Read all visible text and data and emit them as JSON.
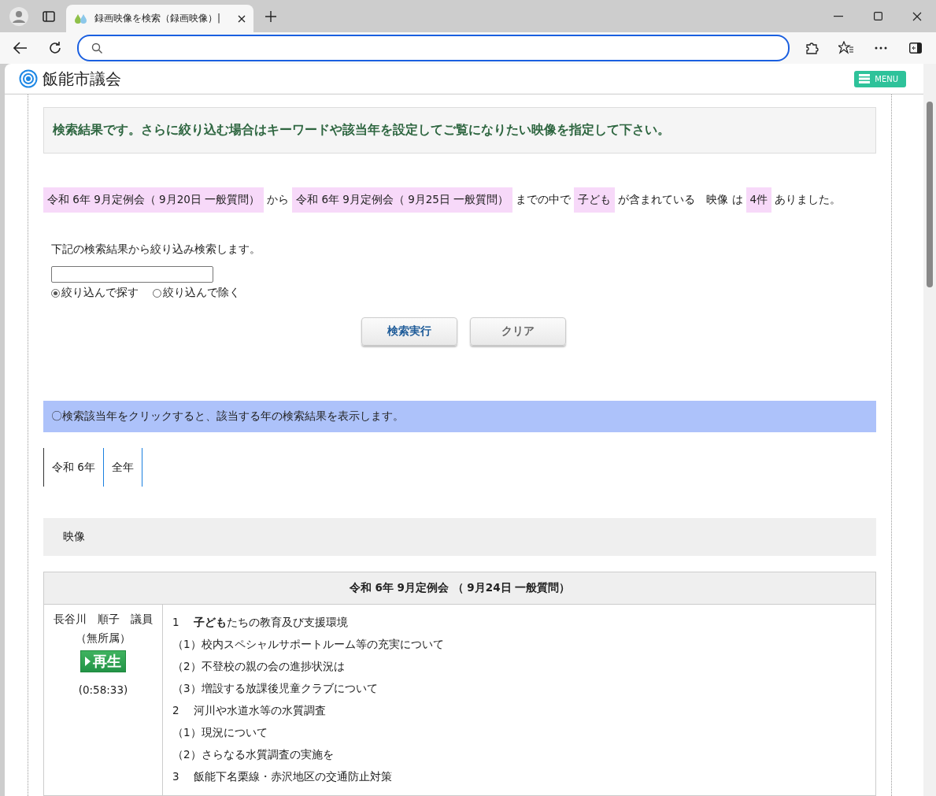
{
  "browser": {
    "tab_title": "録画映像を検索（録画映像）|"
  },
  "site": {
    "title": "飯能市議会",
    "menu_label": "MENU"
  },
  "notice": "検索結果です。さらに絞り込む場合はキーワードや該当年を設定してご覧になりたい映像を指定して下さい。",
  "summary": [
    {
      "kind": "tag",
      "text": "令和 6年 9月定例会（ 9月20日 一般質問）"
    },
    {
      "kind": "plain",
      "text": "から"
    },
    {
      "kind": "tag",
      "text": "令和 6年 9月定例会（ 9月25日 一般質問）"
    },
    {
      "kind": "plain",
      "text": "までの中で"
    },
    {
      "kind": "tag",
      "text": "子ども"
    },
    {
      "kind": "plain",
      "text": "が含まれている　映像 は"
    },
    {
      "kind": "tag",
      "text": "4件"
    },
    {
      "kind": "plain",
      "text": "ありました。"
    }
  ],
  "refine": {
    "label": "下記の検索結果から絞り込み検索します。",
    "options": [
      {
        "label": "絞り込んで探す",
        "selected": true
      },
      {
        "label": "絞り込んで除く",
        "selected": false
      }
    ],
    "buttons": [
      {
        "label": "検索実行",
        "kind": "primary"
      },
      {
        "label": "クリア",
        "kind": "secondary"
      }
    ]
  },
  "year_hint": "〇検索該当年をクリックすると、該当する年の検索結果を表示します。",
  "years": [
    "令和 6年",
    "全年"
  ],
  "section_title": "映像",
  "results": [
    {
      "title": "令和 6年 9月定例会 （ 9月24日 一般質問）",
      "speaker": "長谷川　順子　議員",
      "party": "（無所属）",
      "play_label": "再生",
      "duration": "(0:58:33)",
      "items": [
        {
          "kind": "topic",
          "number": "1",
          "text": "**子ども**たちの教育及び支援環境"
        },
        {
          "kind": "sub",
          "text": "（1）校内スペシャルサポートルーム等の充実について"
        },
        {
          "kind": "sub",
          "text": "（2）不登校の親の会の進捗状況は"
        },
        {
          "kind": "sub",
          "text": "（3）増設する放課後児童クラブについて"
        },
        {
          "kind": "topic",
          "number": "2",
          "text": "河川や水道水等の水質調査"
        },
        {
          "kind": "sub",
          "text": "（1）現況について"
        },
        {
          "kind": "sub",
          "text": "（2）さらなる水質調査の実施を"
        },
        {
          "kind": "topic",
          "number": "3",
          "text": "飯能下名栗線・赤沢地区の交通防止対策"
        }
      ]
    }
  ]
}
